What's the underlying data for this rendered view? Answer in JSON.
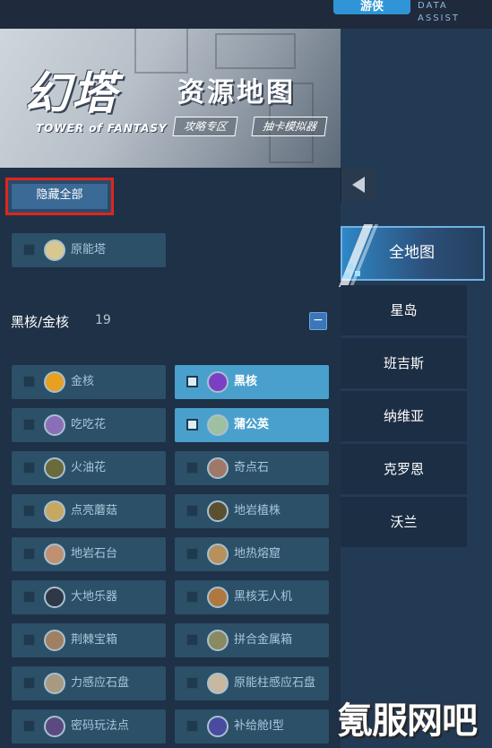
{
  "header": {
    "brand_text": "游侠",
    "brand_sub": "DATA ASSIST"
  },
  "banner": {
    "game_title": "幻塔",
    "game_subtitle": "TOWER of FANTASY",
    "map_title": "资源地图",
    "buttons": [
      "攻略专区",
      "抽卡模拟器"
    ]
  },
  "controls": {
    "hide_all_label": "隐藏全部",
    "collapse_symbol": "−"
  },
  "standalone_item": {
    "label": "原能塔",
    "checked": false,
    "icon": "tower-icon"
  },
  "group": {
    "title": "黑核/金核",
    "count": "19"
  },
  "items": [
    {
      "label": "金核",
      "checked": false,
      "icon": "gold-core-icon",
      "color": "#e8a020"
    },
    {
      "label": "黑核",
      "checked": true,
      "icon": "black-core-icon",
      "color": "#7b3fc4"
    },
    {
      "label": "吃吃花",
      "checked": false,
      "icon": "eating-flower-icon",
      "color": "#8a6fb8"
    },
    {
      "label": "蒲公英",
      "checked": true,
      "icon": "dandelion-icon",
      "color": "#9fc0a0"
    },
    {
      "label": "火油花",
      "checked": false,
      "icon": "fire-flower-icon",
      "color": "#6b6a3a"
    },
    {
      "label": "奇点石",
      "checked": false,
      "icon": "singularity-stone-icon",
      "color": "#a07868"
    },
    {
      "label": "点亮蘑菇",
      "checked": false,
      "icon": "mushroom-icon",
      "color": "#c8a860"
    },
    {
      "label": "地岩植株",
      "checked": false,
      "icon": "rock-plant-icon",
      "color": "#5a5030"
    },
    {
      "label": "地岩石台",
      "checked": false,
      "icon": "stone-platform-icon",
      "color": "#c09070"
    },
    {
      "label": "地热熔窟",
      "checked": false,
      "icon": "geothermal-icon",
      "color": "#b8905a"
    },
    {
      "label": "大地乐器",
      "checked": false,
      "icon": "instrument-icon",
      "color": "#303848"
    },
    {
      "label": "黑核无人机",
      "checked": false,
      "icon": "drone-icon",
      "color": "#b07840"
    },
    {
      "label": "荆棘宝箱",
      "checked": false,
      "icon": "thorn-chest-icon",
      "color": "#a08060"
    },
    {
      "label": "拼合金属箱",
      "checked": false,
      "icon": "metal-box-icon",
      "color": "#8a8a60"
    },
    {
      "label": "力感应石盘",
      "checked": false,
      "icon": "force-disc-icon",
      "color": "#a89a80"
    },
    {
      "label": "原能柱感应石盘",
      "checked": false,
      "icon": "pillar-disc-icon",
      "color": "#c8b8a0"
    },
    {
      "label": "密码玩法点",
      "checked": false,
      "icon": "cipher-icon",
      "color": "#5a4a80"
    },
    {
      "label": "补给舱I型",
      "checked": false,
      "icon": "supply-pod-icon",
      "color": "#4a4aa0"
    }
  ],
  "regions": {
    "all_label": "全地图",
    "list": [
      "星岛",
      "班吉斯",
      "纳维亚",
      "克罗恩",
      "沃兰"
    ]
  },
  "watermark": "氪服网吧"
}
